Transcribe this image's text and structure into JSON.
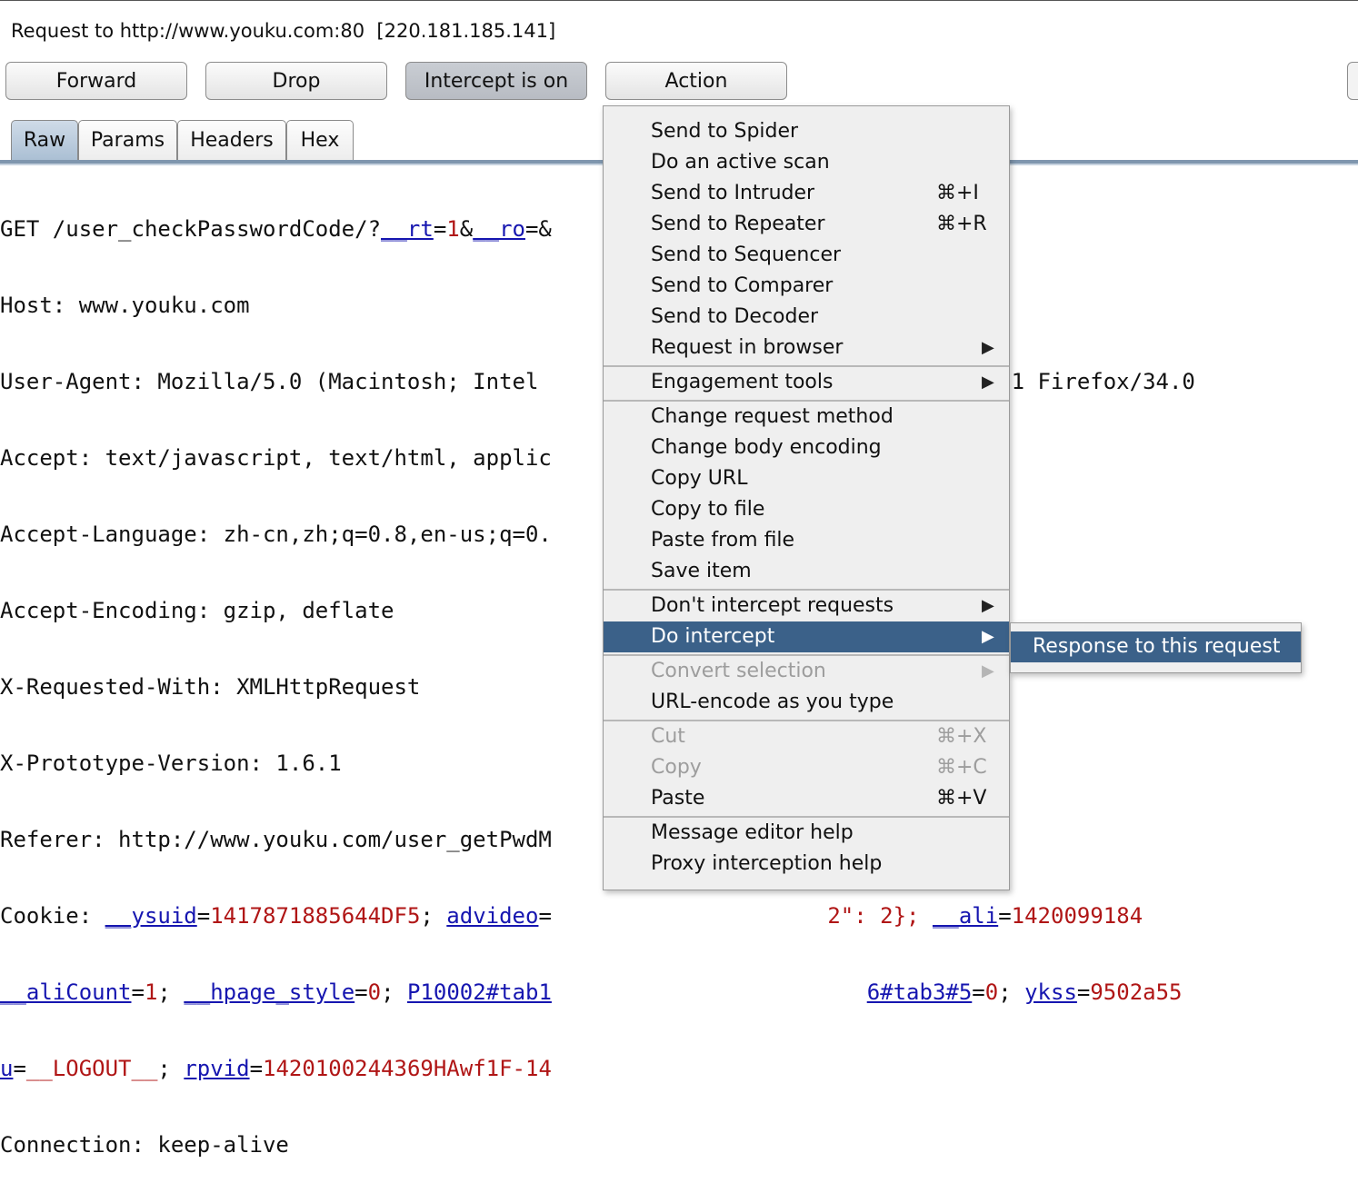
{
  "request_title": "Request to http://www.youku.com:80  [220.181.185.141]",
  "toolbar": {
    "forward": "Forward",
    "drop": "Drop",
    "intercept": "Intercept is on",
    "action": "Action"
  },
  "tabs": [
    "Raw",
    "Params",
    "Headers",
    "Hex"
  ],
  "request_lines": {
    "l1_a": "GET /user_checkPasswordCode/?",
    "l1_k1": "__rt",
    "l1_eq1": "=",
    "l1_v1": "1",
    "l1_amp": "&",
    "l1_k2": "__ro",
    "l1_tail": "=&",
    "l2": "Host: www.youku.com",
    "l3": "User-Agent: Mozilla/5.0 (Macintosh; Intel                          ko/20100101 Firefox/34.0",
    "l4": "Accept: text/javascript, text/html, applic",
    "l5": "Accept-Language: zh-cn,zh;q=0.8,en-us;q=0.",
    "l6": "Accept-Encoding: gzip, deflate",
    "l7": "X-Requested-With: XMLHttpRequest",
    "l8": "X-Prototype-Version: 1.6.1",
    "l9": "Referer: http://www.youku.com/user_getPwdM",
    "l10_a": "Cookie: ",
    "l10_k1": "__ysuid",
    "l10_v1": "1417871885644DF5",
    "l10_k2": "advideo",
    "l10_gap": "                     ",
    "l10_v2": "2\": 2};",
    "l10_k3": "__ali",
    "l10_v3": "1420099184",
    "l11_k1": "__aliCount",
    "l11_v1": "1",
    "l11_k2": "__hpage_style",
    "l11_v2": "0",
    "l11_k3": "P10002#tab1",
    "l11_gap": "                        ",
    "l11_k4": "6#tab3#5",
    "l11_v4": "0",
    "l11_k5": "ykss",
    "l11_v5": "9502a55",
    "l12_k1": "u",
    "l12_v1": "__LOGOUT__",
    "l12_k2": "rpvid",
    "l12_v2": "1420100244369HAwf1F-14",
    "l13": "Connection: keep-alive"
  },
  "menu": {
    "items": [
      {
        "label": "Send to Spider"
      },
      {
        "label": "Do an active scan"
      },
      {
        "label": "Send to Intruder",
        "shortcut": "⌘+I"
      },
      {
        "label": "Send to Repeater",
        "shortcut": "⌘+R"
      },
      {
        "label": "Send to Sequencer"
      },
      {
        "label": "Send to Comparer"
      },
      {
        "label": "Send to Decoder"
      },
      {
        "label": "Request in browser",
        "arrow": "▶"
      },
      {
        "label": "Engagement tools",
        "arrow": "▶"
      },
      {
        "label": "Change request method"
      },
      {
        "label": "Change body encoding"
      },
      {
        "label": "Copy URL"
      },
      {
        "label": "Copy to file"
      },
      {
        "label": "Paste from file"
      },
      {
        "label": "Save item"
      },
      {
        "label": "Don't intercept requests",
        "arrow": "▶"
      },
      {
        "label": "Do intercept",
        "arrow": "▶"
      },
      {
        "label": "Convert selection",
        "arrow": "▶"
      },
      {
        "label": "URL-encode as you type"
      },
      {
        "label": "Cut",
        "shortcut": "⌘+X"
      },
      {
        "label": "Copy",
        "shortcut": "⌘+C"
      },
      {
        "label": "Paste",
        "shortcut": "⌘+V"
      },
      {
        "label": "Message editor help"
      },
      {
        "label": "Proxy interception help"
      }
    ]
  },
  "submenu": {
    "item": "Response to this request"
  },
  "colors": {
    "selection": "#3b6189",
    "param_name": "#1616b0",
    "param_value": "#b01616"
  }
}
